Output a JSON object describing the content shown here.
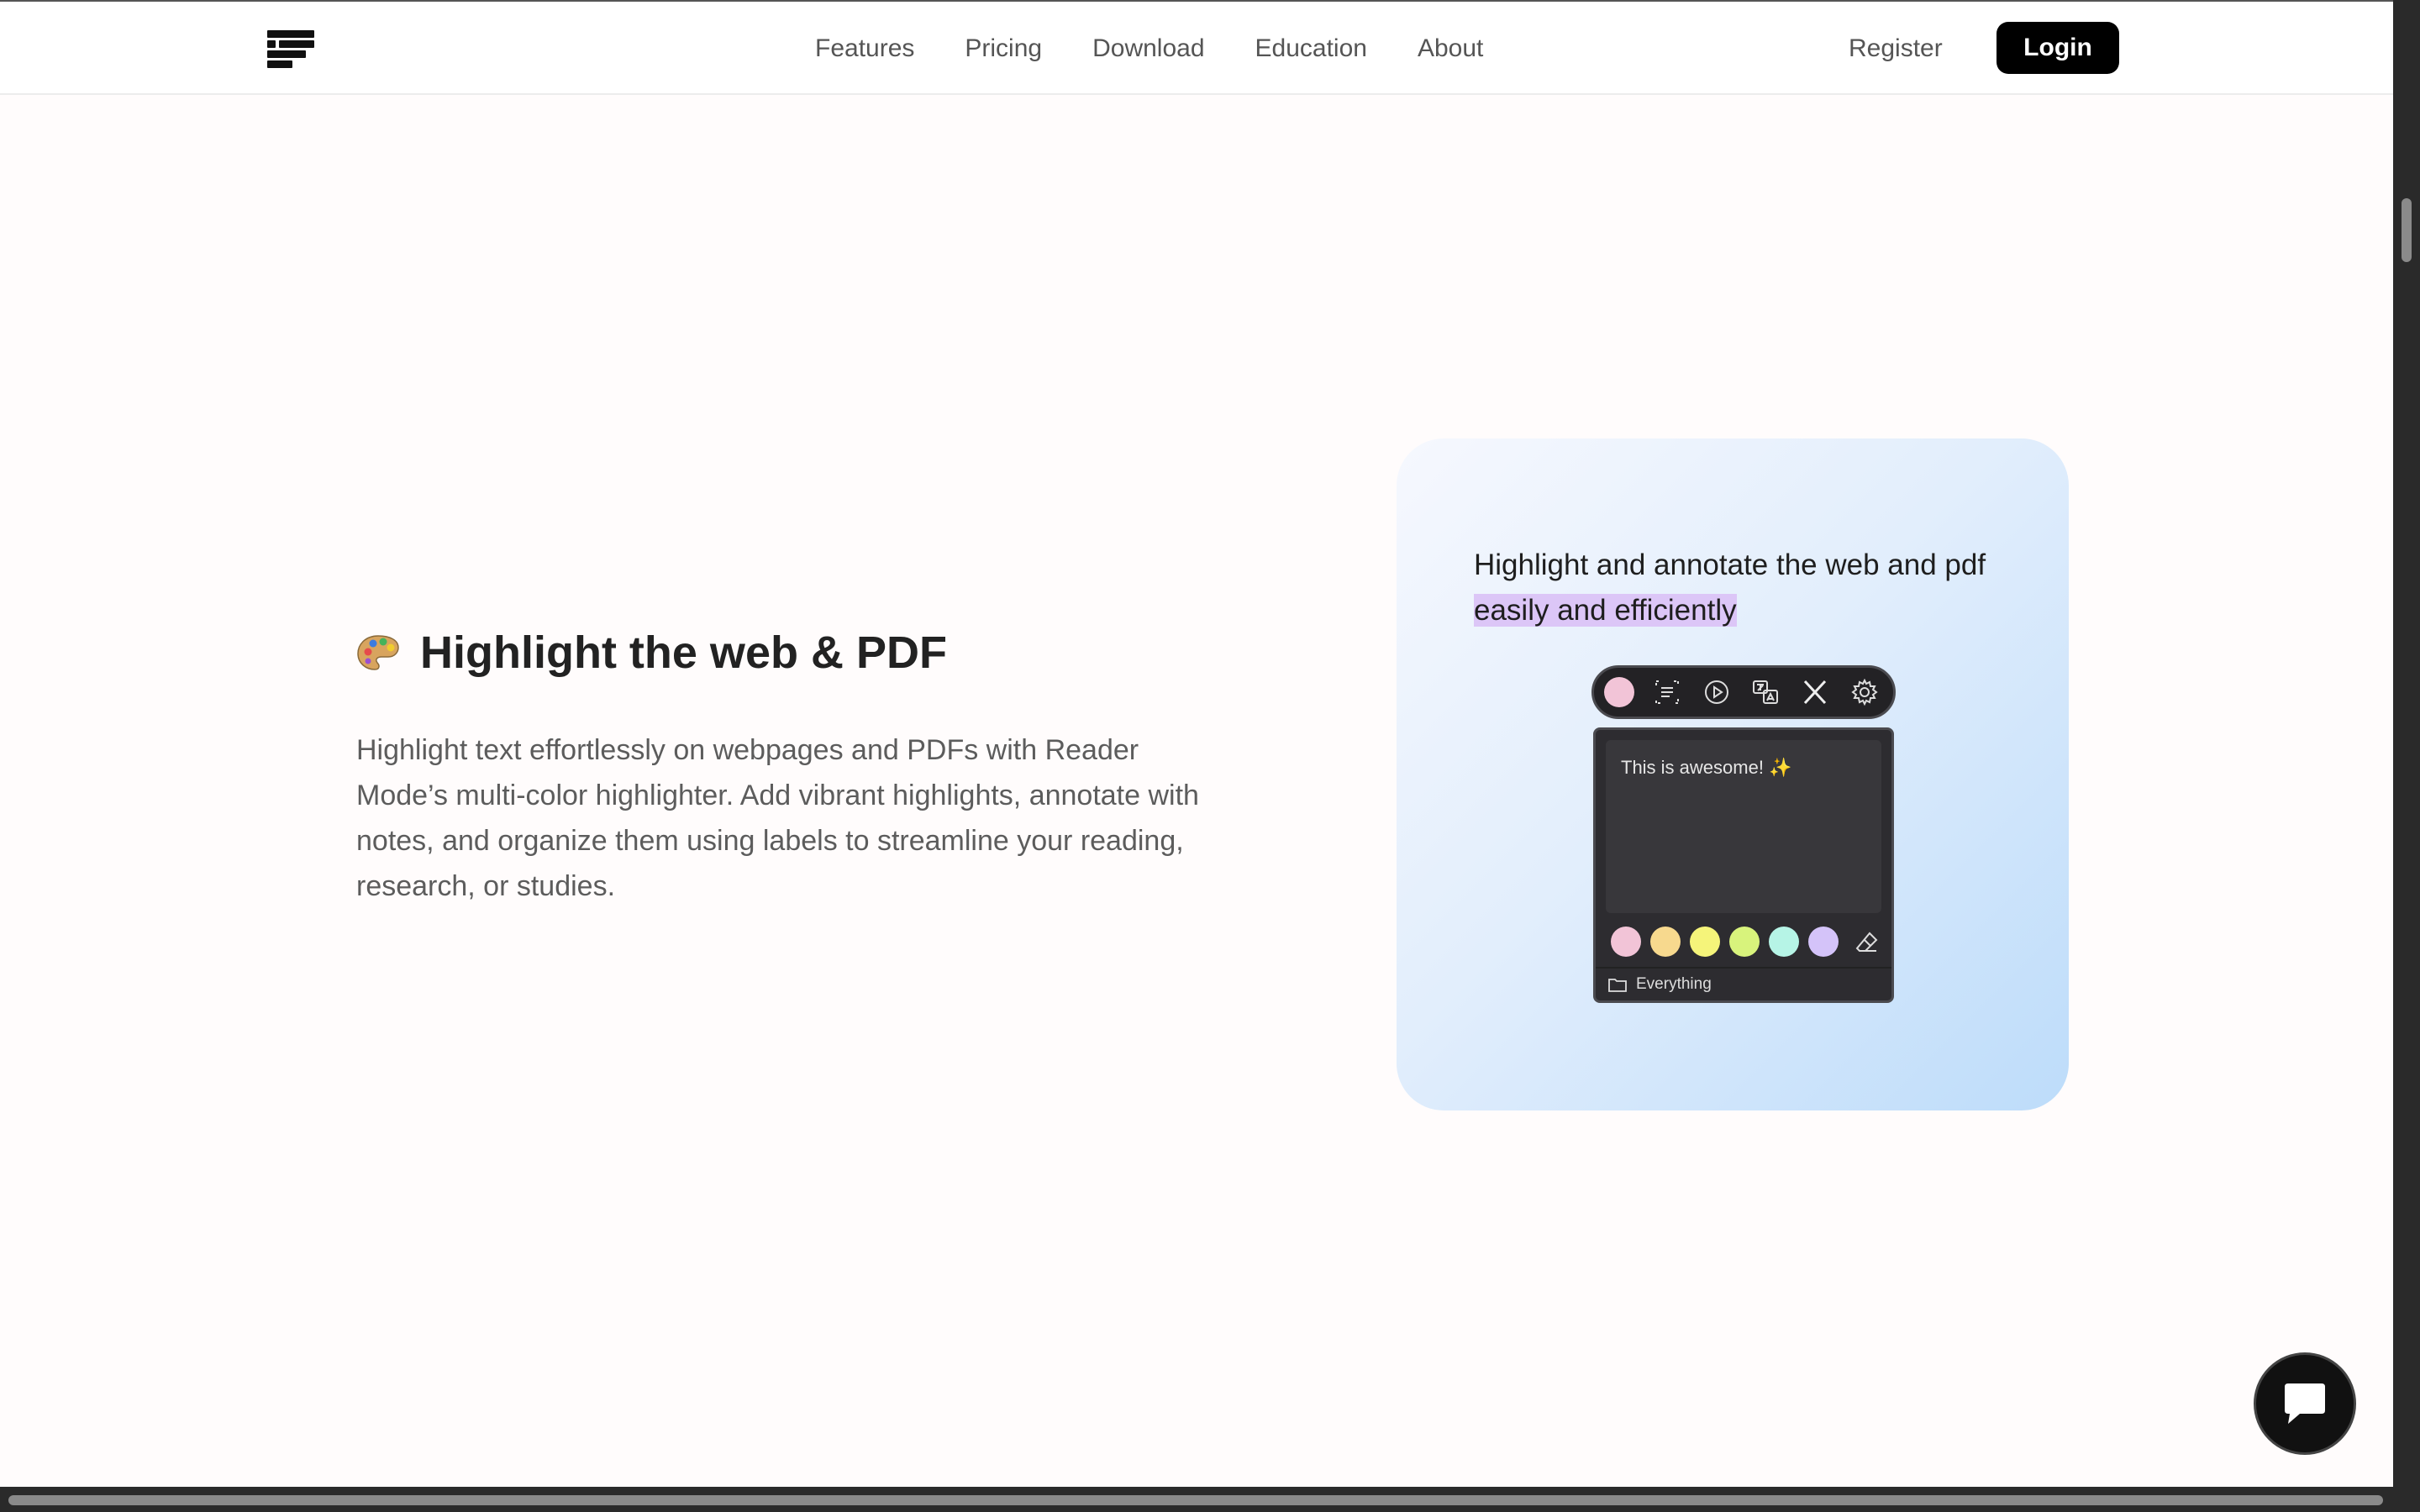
{
  "nav": {
    "links": [
      "Features",
      "Pricing",
      "Download",
      "Education",
      "About"
    ],
    "register": "Register",
    "login": "Login"
  },
  "feature": {
    "icon": "palette-icon",
    "title": "Highlight the web & PDF",
    "description": "Highlight text effortlessly on webpages and PDFs with Reader Mode’s multi-color highlighter. Add vibrant highlights, annotate with notes, and organize them using labels to streamline your reading, research, or studies."
  },
  "demo": {
    "text_plain": "Highlight and annotate the web and pdf ",
    "text_highlighted": "easily and efficiently",
    "highlight_color": "#dcc6f7",
    "toolbar_icons": [
      "color-dot-icon",
      "summary-icon",
      "play-icon",
      "translate-icon",
      "x-share-icon",
      "gear-icon"
    ],
    "note_text": "This is awesome! ✨",
    "swatch_colors": [
      "#f2c4d7",
      "#f7d98e",
      "#f5f47a",
      "#d8f37c",
      "#b6f4e6",
      "#d4c3f9"
    ],
    "label": "Everything"
  },
  "chat": {
    "icon": "chat-bubble-icon"
  }
}
